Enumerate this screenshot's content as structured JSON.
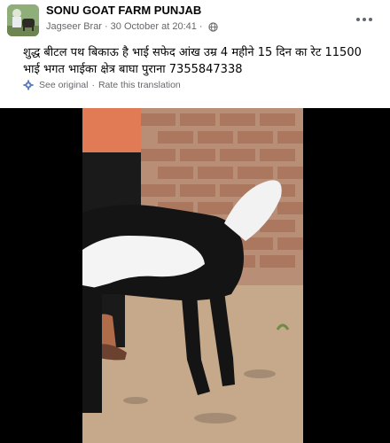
{
  "post": {
    "group_name": "SONU GOAT FARM PUNJAB",
    "author": "Jagseer Brar",
    "separator": "·",
    "date": "30 October at 20:41",
    "separator2": "·",
    "text": "शुद्ध बीटल पथ बिकाऊ है भाई सफेद आंख उम्र 4 महीने 15 दिन का रेट 11500 भाई भगत भाईका क्षेत्र बाघा पुराना 7355847338",
    "see_original": "See original",
    "translation_sep": "·",
    "rate_translation": "Rate this translation"
  },
  "icons": {
    "more": "more-horizontal-icon",
    "privacy": "globe-icon",
    "translate": "gear-icon"
  },
  "colors": {
    "text_primary": "#050505",
    "text_secondary": "#65676b",
    "accent": "#1877f2",
    "media_background": "#000000"
  }
}
